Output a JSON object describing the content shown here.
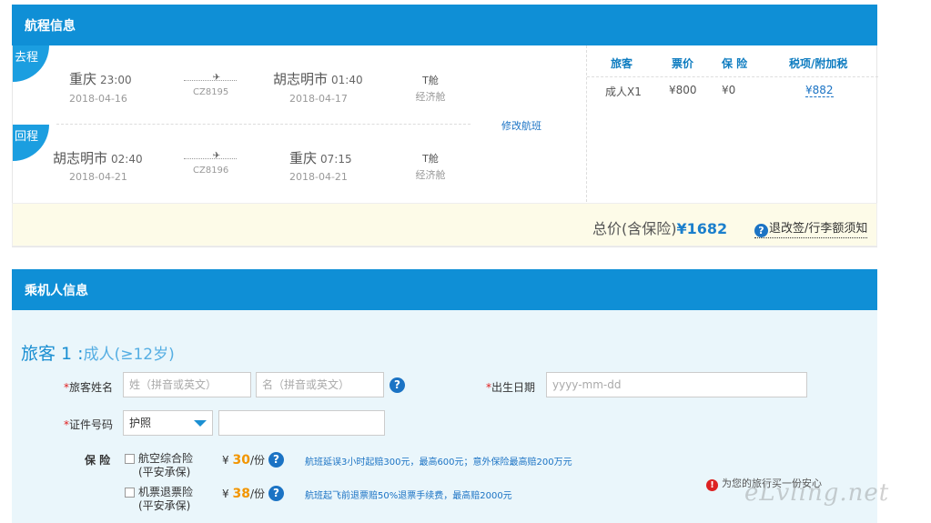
{
  "flight_section": {
    "title": "航程信息",
    "outbound": {
      "tag": "去程",
      "from_city": "重庆",
      "depart_time": "23:00",
      "depart_date": "2018-04-16",
      "flight_no": "CZ8195",
      "to_city": "胡志明市",
      "arrive_time": "01:40",
      "arrive_date": "2018-04-17",
      "cabin": "T舱",
      "cabin_class": "经济舱"
    },
    "return": {
      "tag": "回程",
      "from_city": "胡志明市",
      "depart_time": "02:40",
      "depart_date": "2018-04-21",
      "flight_no": "CZ8196",
      "to_city": "重庆",
      "arrive_time": "07:15",
      "arrive_date": "2018-04-21",
      "cabin": "T舱",
      "cabin_class": "经济舱"
    },
    "modify_link": "修改航班",
    "price_table": {
      "headers": [
        "旅客",
        "票价",
        "保 险",
        "税项/附加税"
      ],
      "row": {
        "passenger": "成人X1",
        "fare": "¥800",
        "insurance": "¥0",
        "tax": "¥882"
      }
    },
    "total_label": "总价(含保险)",
    "total_value": "¥1682",
    "rules_link": "退改签/行李额须知"
  },
  "passenger_section": {
    "title": "乘机人信息",
    "passenger_title": "旅客 1 :",
    "passenger_type": "成人(≥12岁)",
    "name_label": "旅客姓名",
    "surname_placeholder": "姓（拼音或英文）",
    "givenname_placeholder": "名（拼音或英文）",
    "birth_label": "出生日期",
    "birth_placeholder": "yyyy-mm-dd",
    "id_label": "证件号码",
    "id_type": "护照",
    "insurance_label": "保 险",
    "insurance_items": [
      {
        "name": "航空综合险",
        "insurer": "(平安承保)",
        "price": "30",
        "price_unit": "/份",
        "currency": "¥",
        "desc": "航班延误3小时起赔300元，最高600元；意外保险最高赔200万元"
      },
      {
        "name": "机票退票险",
        "insurer": "(平安承保)",
        "price": "38",
        "price_unit": "/份",
        "currency": "¥",
        "desc": "航班起飞前退票赔50%退票手续费，最高赔2000元"
      }
    ],
    "safety_note": "为您的旅行买一份安心"
  },
  "watermark": "eLvling.net"
}
